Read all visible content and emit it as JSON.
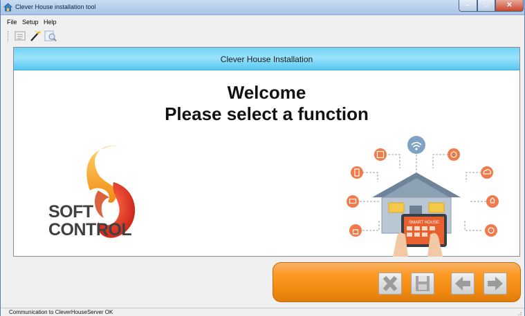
{
  "window": {
    "title": "Clever House installation tool",
    "controls": {
      "minimize": "–",
      "maximize": "□",
      "close": "✕"
    }
  },
  "menu": {
    "items": [
      "File",
      "Setup",
      "Help"
    ]
  },
  "toolbar": {
    "icons": [
      "list-icon",
      "magic-wand-icon",
      "search-document-icon"
    ]
  },
  "content": {
    "header_title": "Clever House Installation",
    "welcome_line1": "Welcome",
    "welcome_line2": "Please select a function",
    "logo_line1": "SOFT",
    "logo_line2": "CONTROL",
    "tablet_label": "SMART HOUSE"
  },
  "actions": [
    "cancel-icon",
    "save-icon",
    "back-arrow-icon",
    "forward-arrow-icon"
  ],
  "status": {
    "text": "Communication to CleverHouseServer OK"
  },
  "colors": {
    "accent_orange": "#f08a10",
    "header_blue": "#6ed3f6",
    "logo_red": "#d62a1e"
  }
}
